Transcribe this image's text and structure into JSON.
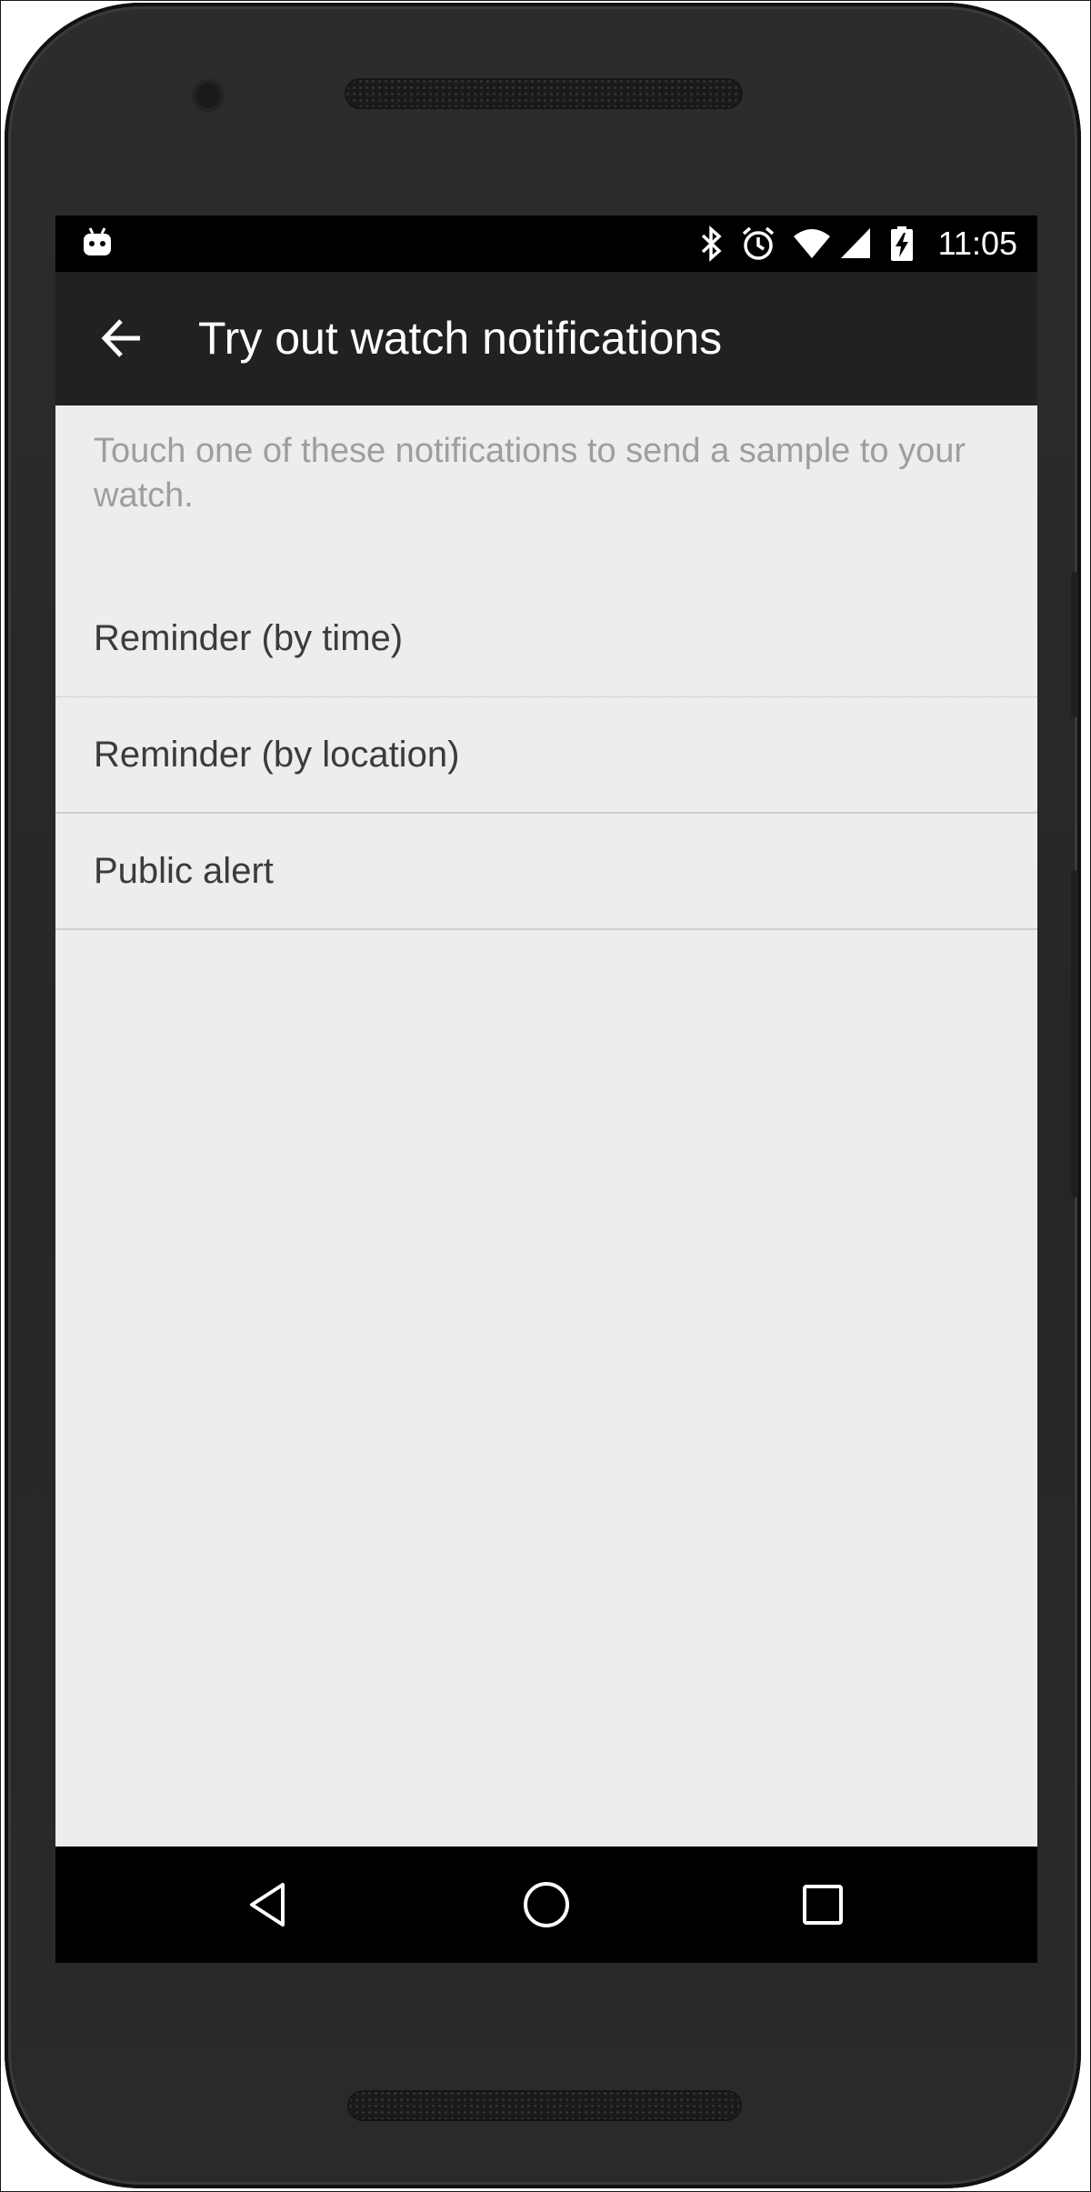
{
  "status_bar": {
    "time": "11:05",
    "icons": [
      "android-notification-icon",
      "bluetooth-icon",
      "alarm-icon",
      "wifi-icon",
      "cell-signal-icon",
      "battery-charging-icon"
    ]
  },
  "app_bar": {
    "title": "Try out watch notifications",
    "back_icon": "arrow-left-icon"
  },
  "content": {
    "intro": "Touch one of these notifications to send a sample to your watch.",
    "items": [
      {
        "label": "Reminder (by time)"
      },
      {
        "label": "Reminder (by location)"
      },
      {
        "label": "Public alert"
      }
    ]
  },
  "nav_bar": {
    "icons": [
      "back-triangle-icon",
      "home-circle-icon",
      "recents-square-icon"
    ]
  },
  "colors": {
    "app_bar": "#212121",
    "status_bar": "#000000",
    "background": "#ededed",
    "intro_text": "#9e9e9e",
    "item_text": "#3b3b3b",
    "device_body": "#2a2a2a"
  }
}
